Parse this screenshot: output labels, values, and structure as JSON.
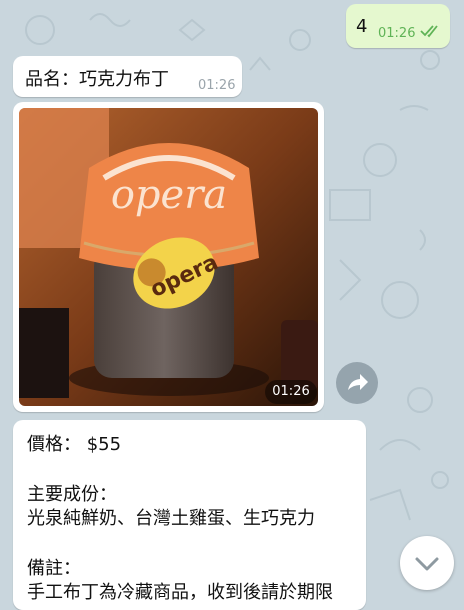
{
  "messages": {
    "outgoing": {
      "text": "4",
      "time": "01:26",
      "status_icon": "double-check-icon"
    },
    "product_name": {
      "text": "品名：巧克力布丁",
      "time": "01:26"
    },
    "photo": {
      "time": "01:26",
      "jar_label": "opera",
      "lid_text": "opera"
    },
    "details": {
      "price": "價格： $55",
      "ingredients_label": "主要成份：",
      "ingredients": "光泉純鮮奶、台灣土雞蛋、生巧克力",
      "notes_label": "備註：",
      "notes": "手工布丁為冷藏商品，收到後請於期限"
    }
  },
  "controls": {
    "share_icon": "share-arrow-icon",
    "scroll_down_icon": "chevron-down-icon"
  },
  "colors": {
    "wallpaper": "#c9d6dd",
    "outgoing_bubble": "#e5f8cf",
    "incoming_bubble": "#ffffff",
    "check_color": "#5fb356"
  }
}
